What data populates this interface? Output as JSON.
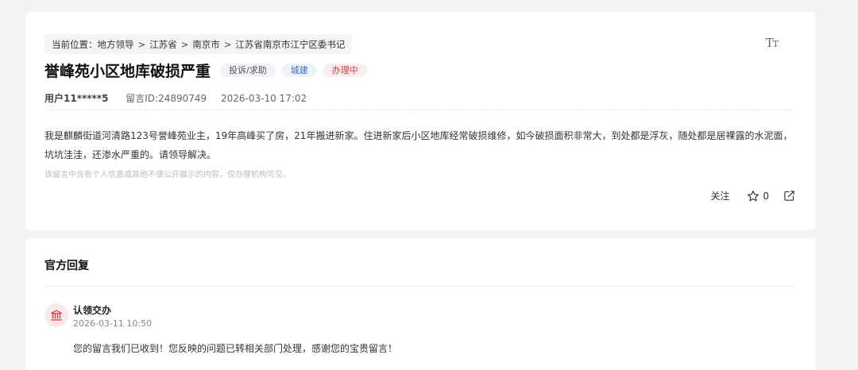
{
  "breadcrumb": {
    "prefix": "当前位置：",
    "items": [
      "地方领导",
      "江苏省",
      "南京市",
      "江苏省南京市江宁区委书记"
    ],
    "separator": ">"
  },
  "font_toggle": {
    "label_big": "T",
    "label_small": "T"
  },
  "message": {
    "title": "誉峰苑小区地库破损严重",
    "tags": [
      "投诉/求助",
      "城建",
      "办理中"
    ],
    "user": "用户11*****5",
    "id_label": "留言ID:24890749",
    "datetime": "2026-03-10 17:02",
    "content": "我是麒麟街道河清路123号誉峰苑业主，19年高峰买了房，21年搬进新家。住进新家后小区地库经常破损维修，如今破损面积非常大，到处都是浮灰，随处都是居裸露的水泥面，坑坑洼洼，还渗水严重的。请领导解决。",
    "notice": "该留言中含有个人信息或其他不便公开展示的内容，仅办理机构可见。"
  },
  "actions": {
    "follow": "关注",
    "like_count": "0"
  },
  "reply": {
    "section_title": "官方回复",
    "name": "认领交办",
    "time": "2026-03-11 10:50",
    "text": "您的留言我们已收到！您反映的问题已转相关部门处理，感谢您的宝贵留言！"
  },
  "colors": {
    "tag_red": "#d8363f",
    "tag_blue": "#3a6cc2",
    "avatar_bg": "#fbe9ea"
  }
}
